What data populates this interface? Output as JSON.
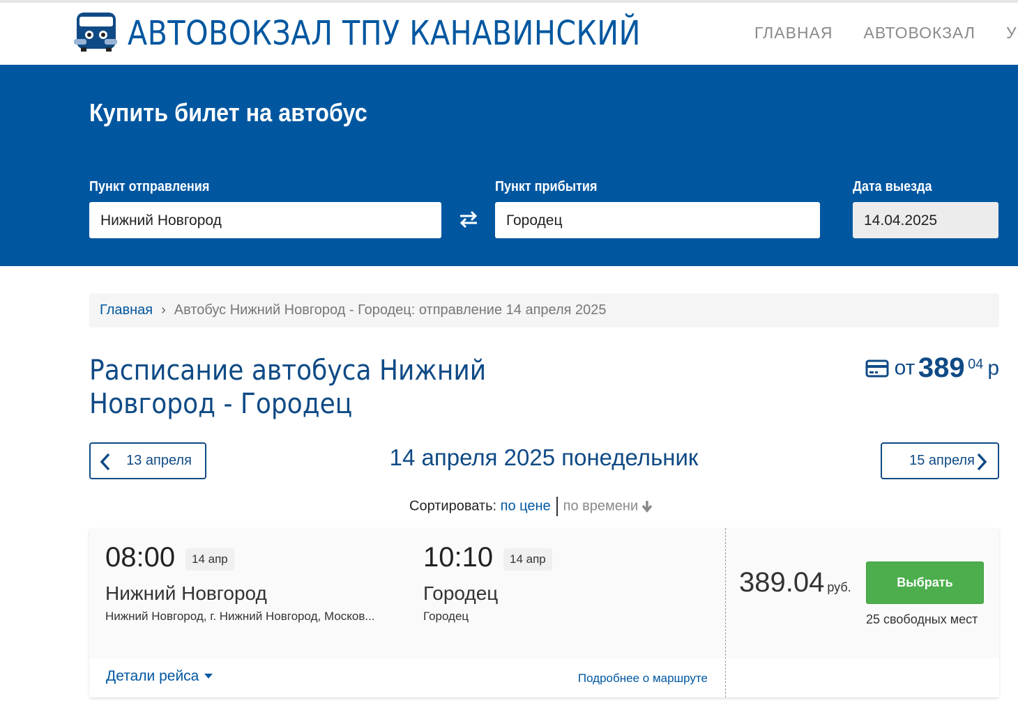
{
  "header": {
    "site_title": "АВТОВОКЗАЛ ТПУ КАНАВИНСКИЙ",
    "nav": [
      "ГЛАВНАЯ",
      "АВТОВОКЗАЛ",
      "УСЛ"
    ]
  },
  "search": {
    "heading": "Купить билет на автобус",
    "departure_label": "Пункт отправления",
    "departure_value": "Нижний Новгород",
    "arrival_label": "Пункт прибытия",
    "arrival_value": "Городец",
    "date_label": "Дата выезда",
    "date_value": "14.04.2025",
    "swap_icon": "swap-arrows-icon"
  },
  "breadcrumb": {
    "home": "Главная",
    "separator": "›",
    "current": "Автобус Нижний Новгород - Городец: отправление 14 апреля 2025"
  },
  "schedule": {
    "title": "Расписание автобуса Нижний Новгород - Городец",
    "price_prefix": "от",
    "price_main": "389",
    "price_kopecks": "04",
    "price_currency": "р",
    "prev_day": "13 апреля",
    "next_day": "15 апреля",
    "current_date": "14 апреля 2025 понедельник"
  },
  "sort": {
    "label": "Сортировать:",
    "by_price": "по цене",
    "by_time": "по времени"
  },
  "trip": {
    "departure_time": "08:00",
    "departure_date": "14 апр",
    "departure_city": "Нижний Новгород",
    "departure_stop": "Нижний Новгород, г. Нижний Новгород, Москов...",
    "arrival_time": "10:10",
    "arrival_date": "14 апр",
    "arrival_city": "Городец",
    "arrival_stop": "Городец",
    "price": "389.04",
    "currency": "руб.",
    "select_label": "Выбрать",
    "seats": "25 свободных мест",
    "details_label": "Детали рейса",
    "route_more": "Подробнее о маршруте"
  },
  "colors": {
    "brand_blue": "#0057a0",
    "title_blue": "#0f4a85",
    "select_green": "#4cae4c"
  }
}
